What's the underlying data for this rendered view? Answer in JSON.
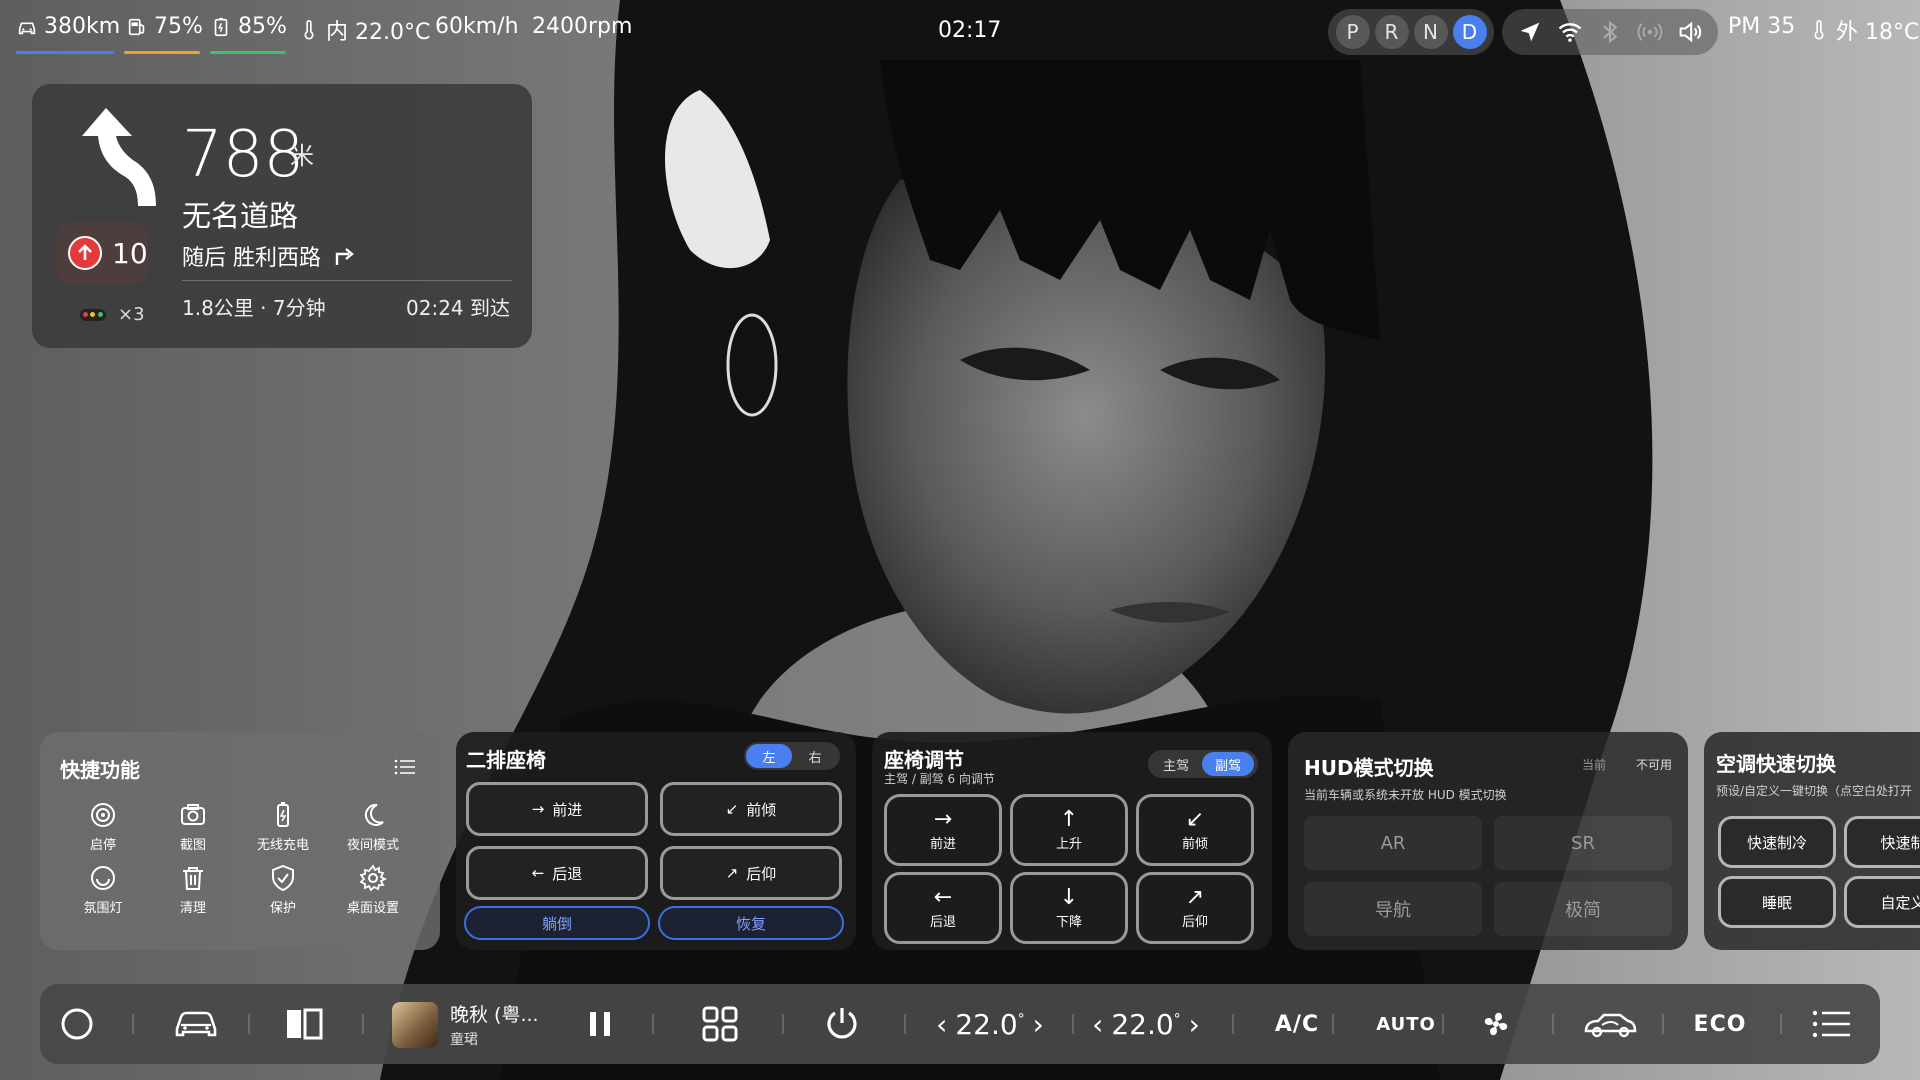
{
  "status_bar": {
    "range": "380km",
    "fuel": "75%",
    "battery": "85%",
    "inside_temp": "内 22.0°C",
    "speed": "60km/h",
    "rpm": "2400rpm",
    "clock": "02:17",
    "gears": [
      "P",
      "R",
      "N",
      "D"
    ],
    "active_gear": "D",
    "pm": "PM 35",
    "outside_temp": "外 18°C",
    "underline_colors": [
      "#4a7ff0",
      "#f0a030",
      "#3fc06a"
    ]
  },
  "navigation": {
    "distance": "788",
    "distance_unit": "米",
    "road": "无名道路",
    "next_turn": "随后 胜利西路",
    "speed_limit": "10",
    "traffic_lights": "×3",
    "remaining": "1.8公里 · 7分钟",
    "eta": "02:24 到达"
  },
  "quick_functions": {
    "title": "快捷功能",
    "items": [
      {
        "label": "启停",
        "icon": "target-icon"
      },
      {
        "label": "截图",
        "icon": "camera-icon"
      },
      {
        "label": "无线充电",
        "icon": "battery-charge-icon"
      },
      {
        "label": "夜间模式",
        "icon": "moon-icon"
      },
      {
        "label": "氛围灯",
        "icon": "ambient-light-icon"
      },
      {
        "label": "清理",
        "icon": "trash-icon"
      },
      {
        "label": "保护",
        "icon": "shield-icon"
      },
      {
        "label": "桌面设置",
        "icon": "gear-icon"
      }
    ]
  },
  "rear_seat": {
    "title": "二排座椅",
    "sides": [
      "左",
      "右"
    ],
    "active_side": "左",
    "buttons": [
      {
        "arrow": "→",
        "label": "前进"
      },
      {
        "arrow": "↙",
        "label": "前倾"
      },
      {
        "arrow": "←",
        "label": "后退"
      },
      {
        "arrow": "↗",
        "label": "后仰"
      }
    ],
    "recline": "躺倒",
    "restore": "恢复"
  },
  "seat_adjust": {
    "title": "座椅调节",
    "subtitle": "主驾 / 副驾 6 向调节",
    "seats": [
      "主驾",
      "副驾"
    ],
    "active_seat": "副驾",
    "buttons": [
      {
        "arrow": "→",
        "label": "前进"
      },
      {
        "arrow": "↑",
        "label": "上升"
      },
      {
        "arrow": "↙",
        "label": "前倾"
      },
      {
        "arrow": "←",
        "label": "后退"
      },
      {
        "arrow": "↓",
        "label": "下降"
      },
      {
        "arrow": "↗",
        "label": "后仰"
      }
    ]
  },
  "hud": {
    "title": "HUD模式切换",
    "current_label": "当前",
    "current_value": "不可用",
    "subtitle": "当前车辆或系统未开放 HUD 模式切换",
    "modes": [
      "AR",
      "SR",
      "导航",
      "极简"
    ]
  },
  "ac_quick": {
    "title": "空调快速切换",
    "subtitle": "预设/自定义一键切换（点空白处打开",
    "buttons": [
      "快速制冷",
      "快速制",
      "睡眠",
      "自定义"
    ]
  },
  "dock": {
    "song_title": "晚秋 (粤...",
    "song_artist": "童珺",
    "left_temp": "22.0",
    "right_temp": "22.0",
    "temp_unit": "°",
    "ac": "A/C",
    "auto": "AUTO",
    "eco": "ECO"
  }
}
